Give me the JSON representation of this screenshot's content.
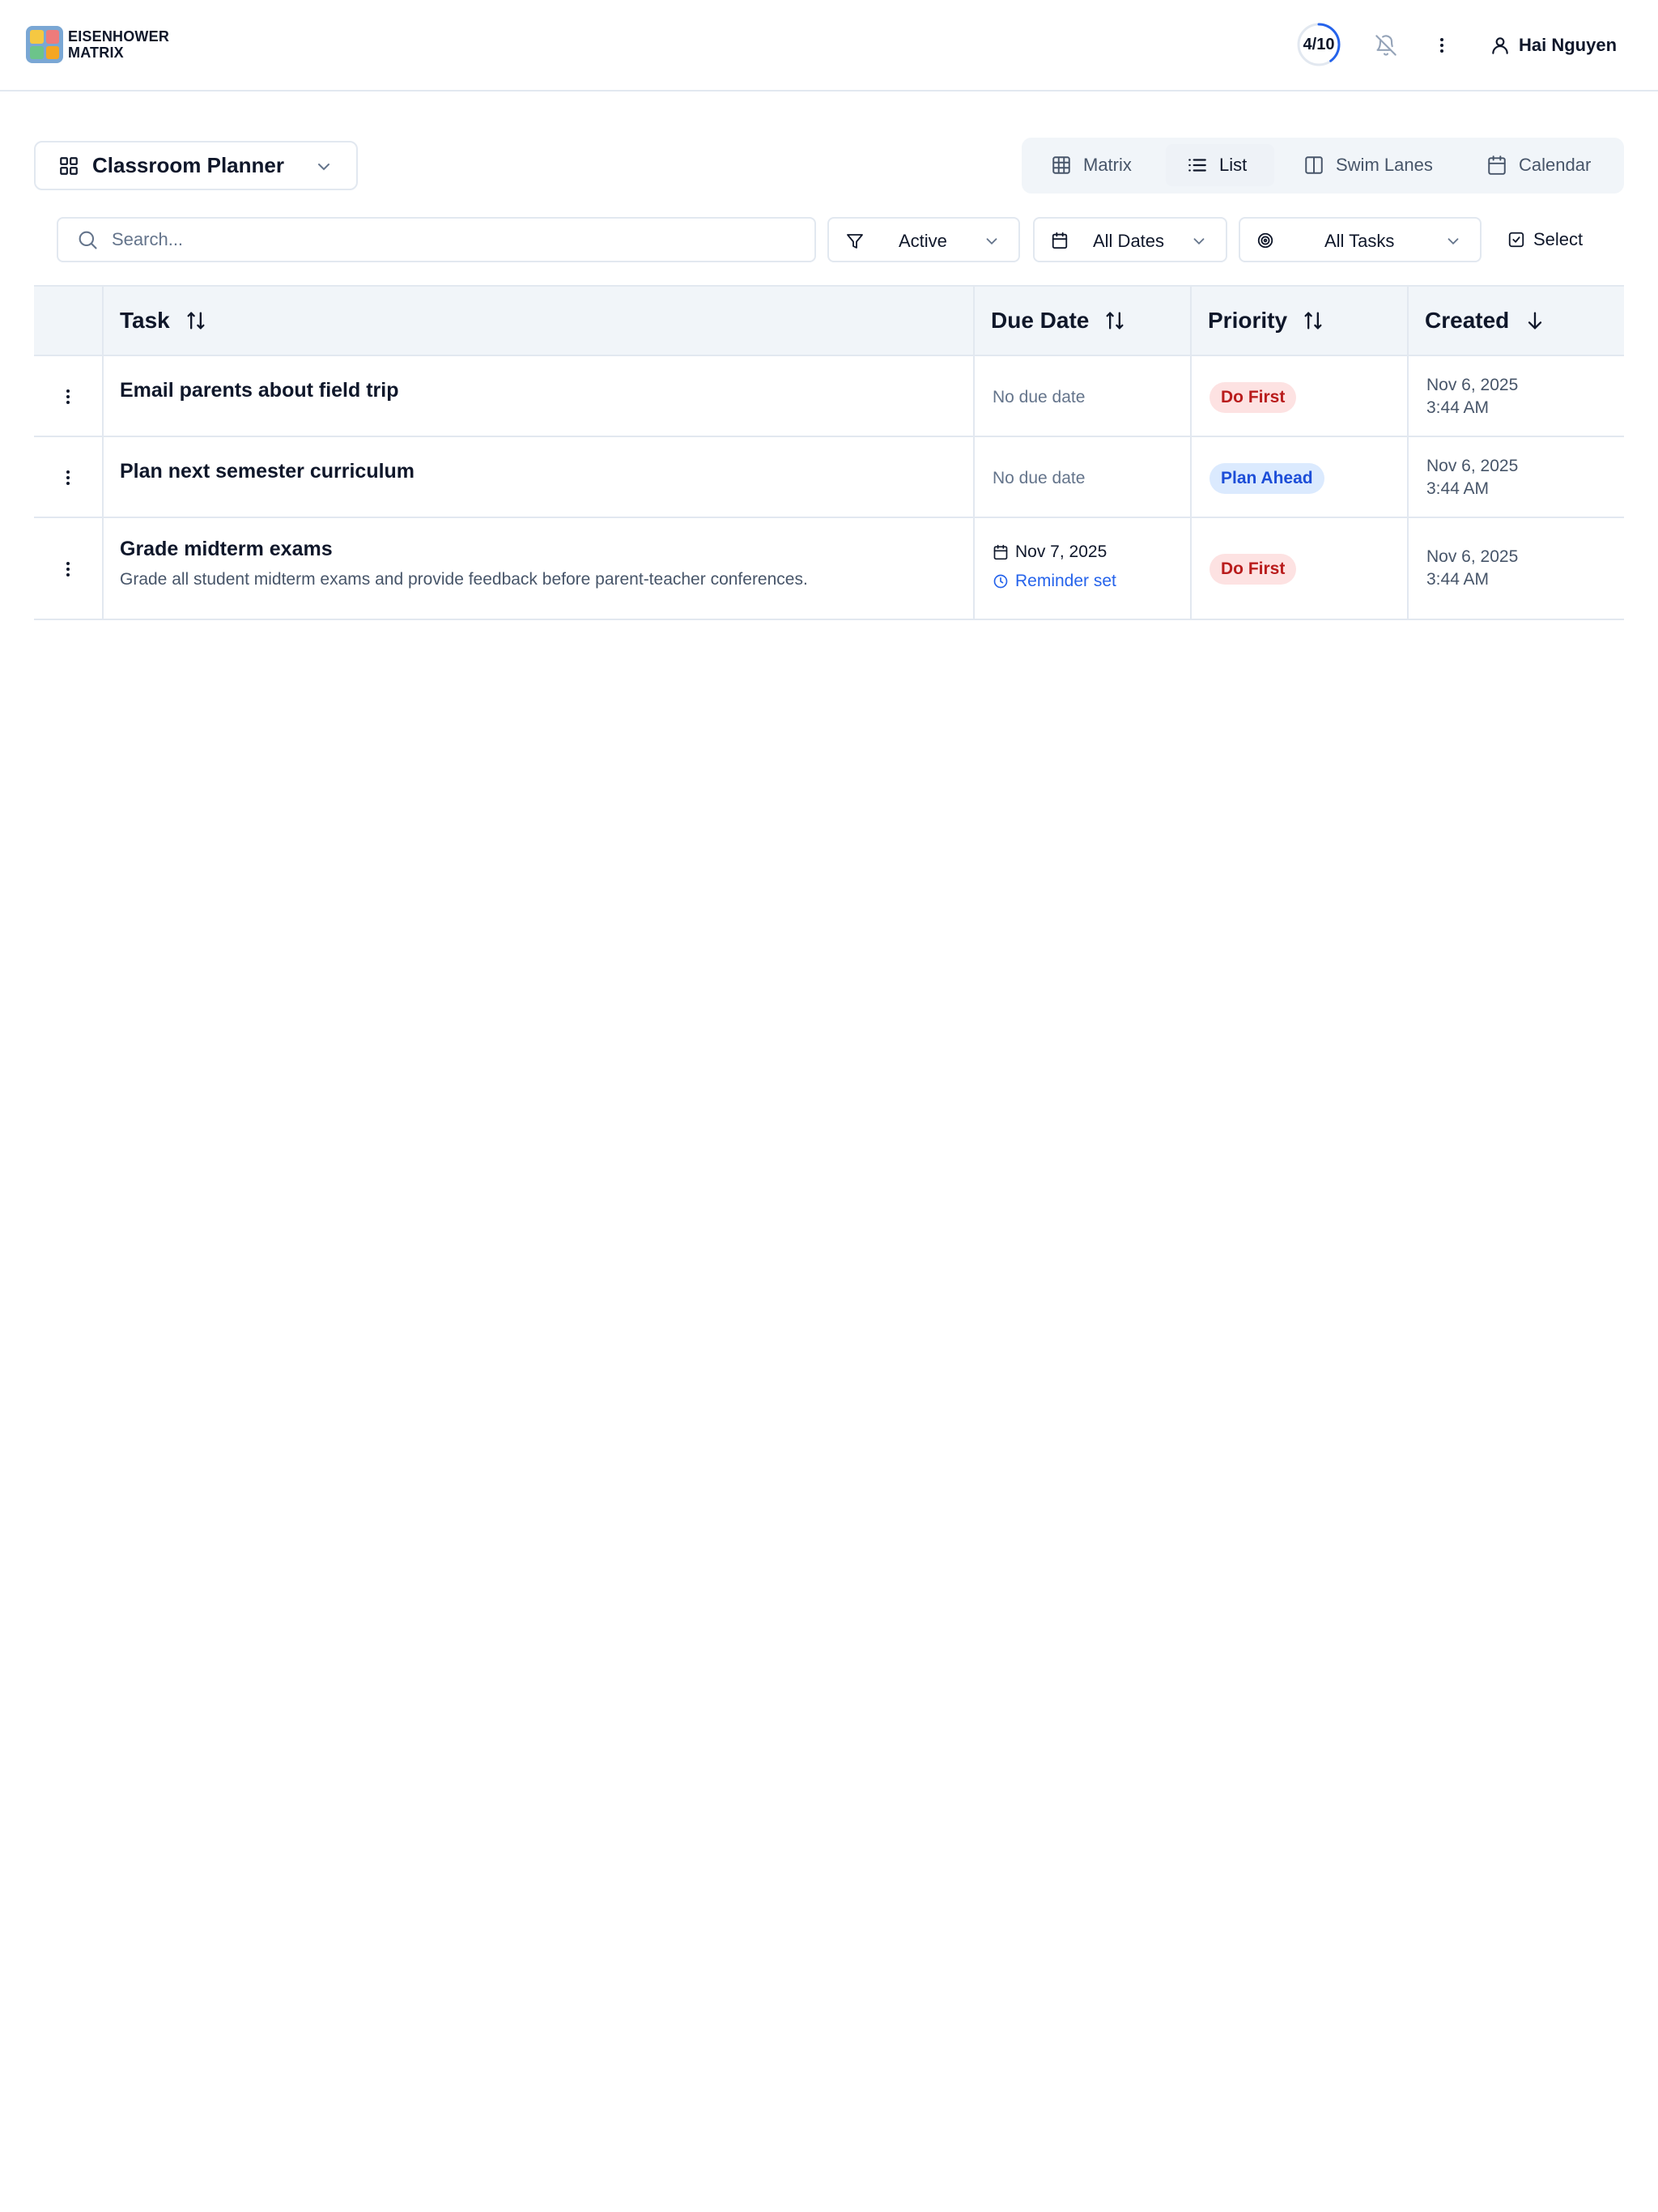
{
  "header": {
    "logo_line1": "EISENHOWER",
    "logo_line2": "MATRIX",
    "progress_label": "4/10",
    "progress_fraction": 0.4,
    "user_name": "Hai Nguyen",
    "icons": [
      "bell-off-icon",
      "more-vertical-icon",
      "user-icon"
    ]
  },
  "board": {
    "name": "Classroom Planner"
  },
  "view_tabs": [
    {
      "label": "Matrix",
      "icon": "grid-icon",
      "active": false
    },
    {
      "label": "List",
      "icon": "list-icon",
      "active": true
    },
    {
      "label": "Swim Lanes",
      "icon": "columns-icon",
      "active": false
    },
    {
      "label": "Calendar",
      "icon": "calendar-icon",
      "active": false
    }
  ],
  "filters": {
    "search_placeholder": "Search...",
    "status": "Active",
    "dates": "All Dates",
    "tasks": "All Tasks",
    "select_label": "Select"
  },
  "table": {
    "columns": [
      "Task",
      "Due Date",
      "Priority",
      "Created"
    ],
    "rows": [
      {
        "title": "Email parents about field trip",
        "description": "",
        "due": "No due date",
        "reminder": "",
        "priority": "Do First",
        "created_date": "Nov 6, 2025",
        "created_time": "3:44 AM"
      },
      {
        "title": "Plan next semester curriculum",
        "description": "",
        "due": "No due date",
        "reminder": "",
        "priority": "Plan Ahead",
        "created_date": "Nov 6, 2025",
        "created_time": "3:44 AM"
      },
      {
        "title": "Grade midterm exams",
        "description": "Grade all student midterm exams and provide feedback before parent-teacher conferences.",
        "due": "Nov 7, 2025",
        "reminder": "Reminder set",
        "priority": "Do First",
        "created_date": "Nov 6, 2025",
        "created_time": "3:44 AM"
      }
    ]
  },
  "colors": {
    "accent": "#2563eb",
    "do_first_bg": "#fde2e2",
    "do_first_text": "#b91c1c",
    "plan_ahead_bg": "#dbeafe",
    "plan_ahead_text": "#1d4ed8",
    "border": "#e2e8f0",
    "header_bg": "#f1f5f9"
  }
}
